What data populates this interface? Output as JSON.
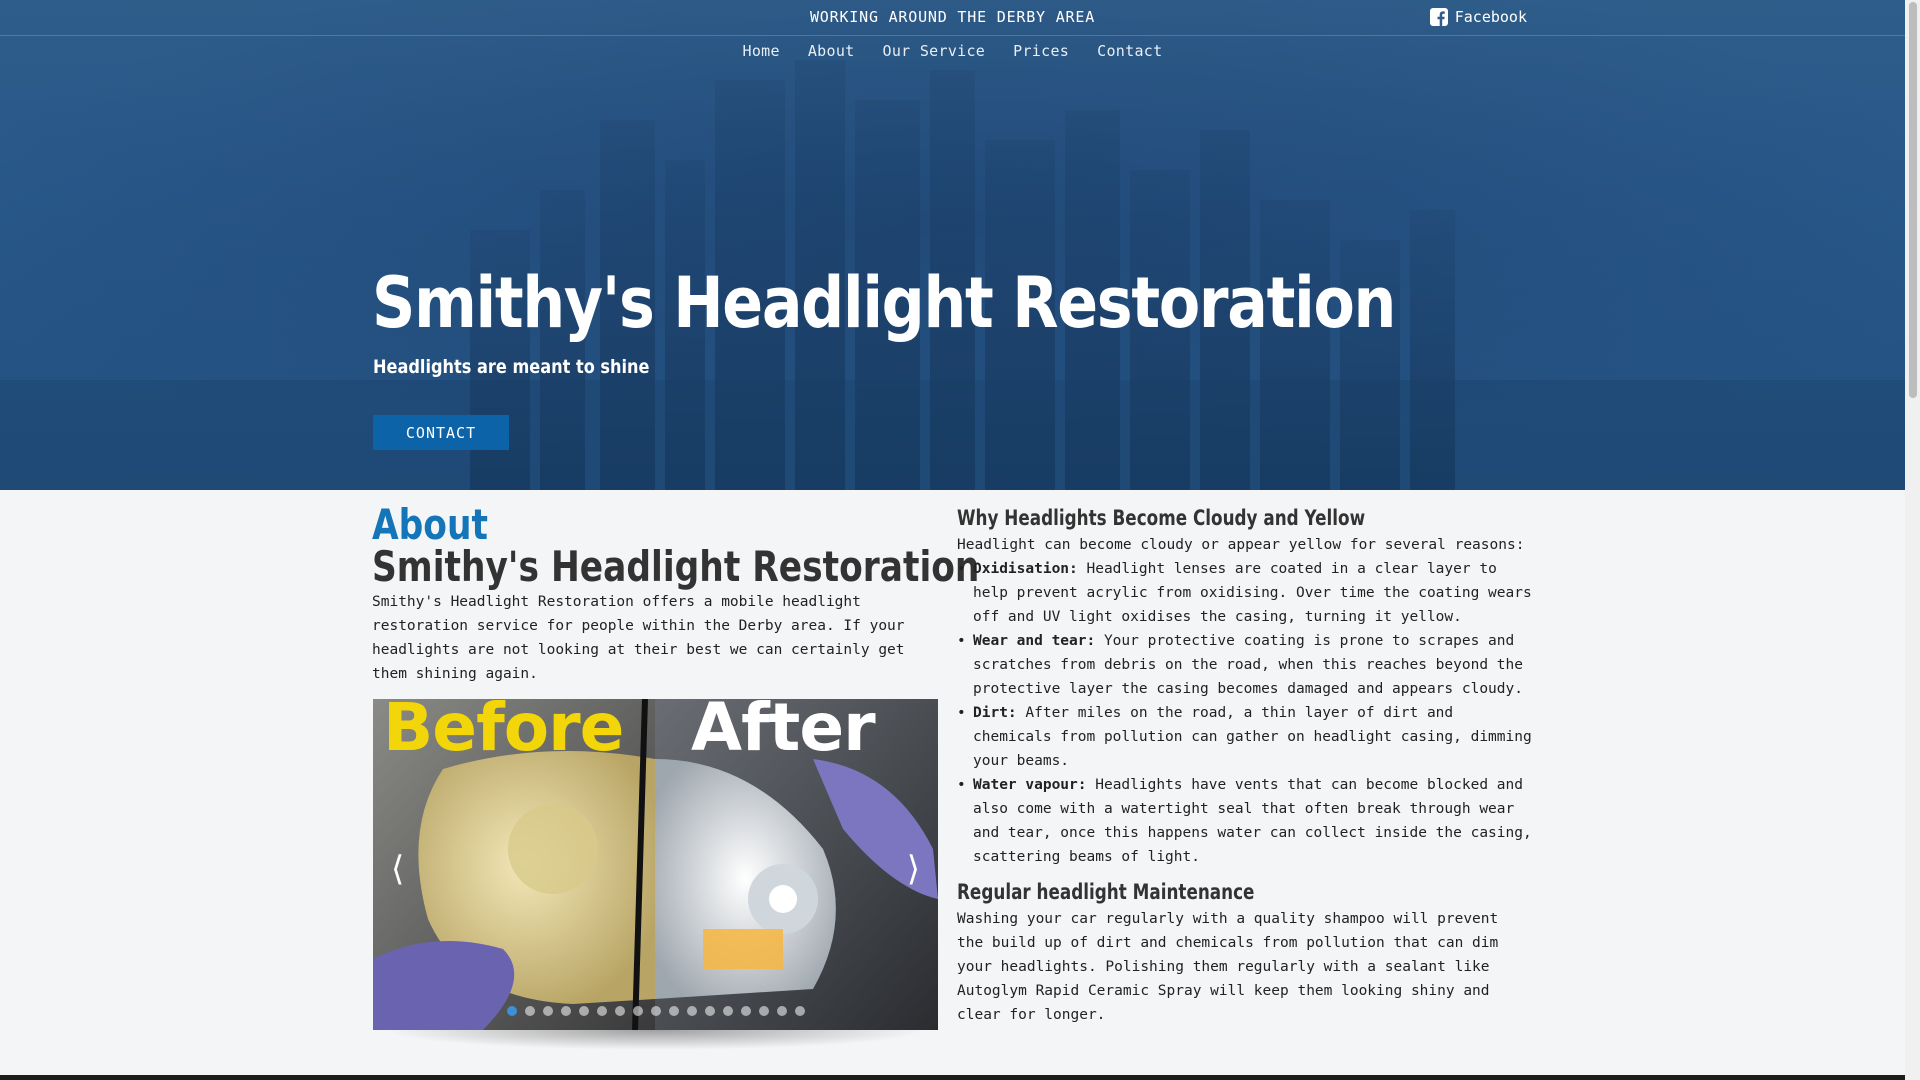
{
  "topbar": {
    "announcement": "WORKING AROUND THE DERBY AREA",
    "facebook_label": "Facebook",
    "facebook_icon": "facebook-icon"
  },
  "nav": {
    "items": [
      "Home",
      "About",
      "Our Service",
      "Prices",
      "Contact"
    ]
  },
  "hero": {
    "title": "Smithy's Headlight Restoration",
    "subtitle": "Headlights are meant to shine",
    "button_label": "CONTACT"
  },
  "about": {
    "heading": "About",
    "subheading": "Smithy's Headlight Restoration",
    "text": "Smithy's Headlight Restoration offers a mobile headlight restoration service for people within the Derby area. If your headlights are not looking at their best we can certainly get them shining again."
  },
  "slider": {
    "before_label": "Before",
    "after_label": "After",
    "prev_icon": "chevron-left-icon",
    "next_icon": "chevron-right-icon",
    "slide_count": 17,
    "active_index": 0
  },
  "why": {
    "heading": "Why Headlights Become Cloudy and Yellow",
    "intro": "Headlight can become cloudy or appear yellow for several reasons:",
    "reasons": [
      {
        "term": "Oxidisation:",
        "text": " Headlight lenses are coated in a clear layer to help prevent acrylic from oxidising. Over time the coating wears off and UV light oxidises the casing, turning it yellow."
      },
      {
        "term": "Wear and tear:",
        "text": " Your protective coating is prone to scrapes and scratches from debris on the road, when this reaches beyond the protective layer the casing becomes damaged and appears cloudy."
      },
      {
        "term": "Dirt:",
        "text": " After miles on the road, a thin layer of dirt and chemicals from pollution can gather on headlight casing, dimming your beams."
      },
      {
        "term": "Water vapour:",
        "text": " Headlights have vents that can become blocked and also come with a watertight seal that often break through wear and tear, once this happens water can collect inside the casing, scattering beams of light."
      }
    ]
  },
  "maintenance": {
    "heading": "Regular headlight Maintenance",
    "text": "Washing your car regularly with a quality shampoo will prevent the build up of dirt and chemicals from pollution that can dim your headlights. Polishing them regularly with a sealant like Autoglym Rapid Ceramic Spray will keep them looking shiny and clear for longer."
  },
  "colors": {
    "hero_bg": "#2f5d8a",
    "accent": "#1475b8",
    "button": "#0c63a8",
    "before_label": "#f2d60a"
  }
}
